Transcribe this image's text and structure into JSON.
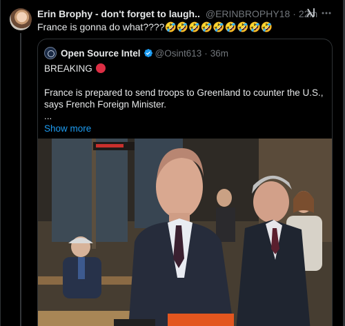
{
  "post": {
    "author_name": "Erin Brophy - don't forget to laugh..",
    "handle": "@ERINBROPHY18",
    "separator": "·",
    "time": "22m",
    "text": "France is gonna do what????🤣🤣🤣🤣🤣🤣🤣🤣🤣",
    "grok_icon": "grok-icon",
    "more_icon": "more-icon",
    "verified_color": "#1d9bf0"
  },
  "quote": {
    "author_name": "Open Source Intel",
    "handle": "@Osint613",
    "separator": "·",
    "time": "36m",
    "breaking_label": "BREAKING",
    "line1": "France is prepared to send troops to Greenland to counter the U.S.,",
    "line2": "says French Foreign Minister.",
    "ellipsis": "...",
    "show_more": "Show more",
    "link_color": "#1d9bf0",
    "photo": "news-photo"
  }
}
